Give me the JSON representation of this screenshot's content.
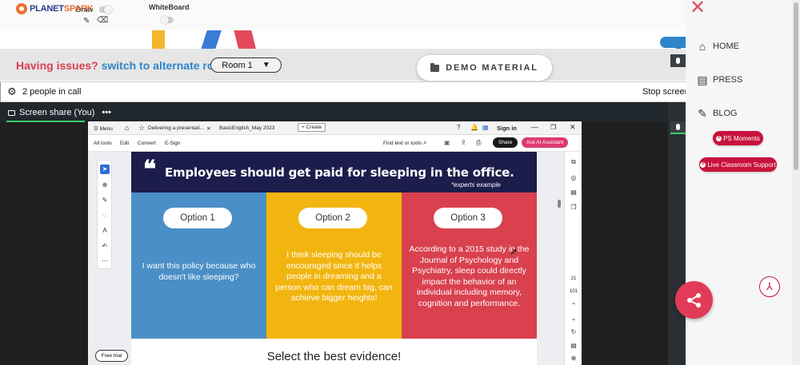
{
  "topbar": {
    "logo_main": "PLANET",
    "logo_spark": "SPARK",
    "draw_label": "Draw",
    "whiteboard_label": "WhiteBoard",
    "pencil_glyph": "✎",
    "eraser_glyph": "⌫"
  },
  "issues": {
    "prefix": "Having issues?",
    "link": "switch to alternate room",
    "room_value": "Room 1",
    "room_arrow": "▼"
  },
  "demo_button": {
    "label": "DEMO MATERIAL"
  },
  "call": {
    "people": "2 people in call",
    "stop": "Stop screen"
  },
  "share": {
    "title": "Screen share (You)",
    "menu": "•••"
  },
  "acrobat": {
    "tabs": {
      "menu": "☰ Menu",
      "home_glyph": "⌂",
      "star_glyph": "☆",
      "tab1": "Delivering a presentati...",
      "tab1_close": "✕",
      "tab2": "BasicEnglish_May 2023",
      "new_tab": "+ Create",
      "help_glyph": "?",
      "bell_glyph": "🔔",
      "apps_glyph": "▦",
      "signin": "Sign in",
      "min_glyph": "—",
      "max_glyph": "❐",
      "close_glyph": "✕"
    },
    "menubar": {
      "all_tools": "All tools",
      "edit": "Edit",
      "convert": "Convert",
      "esign": "E-Sign",
      "find": "Find text or tools",
      "search_glyph": "⌕",
      "save_glyph": "▣",
      "upload_glyph": "⇪",
      "print_glyph": "⎙",
      "share": "Share",
      "ai": "Ask AI Assistant"
    },
    "tools": [
      "➤",
      "⊕",
      "✎",
      "◌",
      "A",
      "✍",
      "⋯"
    ],
    "right_tools": [
      "⧉",
      "◎",
      "▤",
      "❐"
    ],
    "page_current": "21",
    "page_total": "101",
    "nav_glyphs": [
      "⌃",
      "⌄",
      "↻",
      "▤",
      "⊕"
    ],
    "free_trial": "Free trial"
  },
  "slide": {
    "quote": "❝",
    "title": "Employees should get paid for sleeping in the office.",
    "subtitle": "*experts example",
    "options": [
      {
        "label": "Option 1",
        "text": "I want this policy because who doesn't like sleeping?"
      },
      {
        "label": "Option 2",
        "text": "I think sleeping should be encouraged since it helps people in dreaming and a person who can dream big, can achieve bigger heights!"
      },
      {
        "label": "Option 3",
        "text": "According to a 2015 study in the Journal of Psychology and Psychiatry, sleep could directly impact the behavior of an individual including memory, cognition and performance."
      }
    ],
    "footer": "Select the best evidence!"
  },
  "rightnav": {
    "close_glyph": "✕",
    "home": "HOME",
    "home_glyph": "⌂",
    "press": "PRESS",
    "press_glyph": "▤",
    "blog": "BLOG",
    "blog_glyph": "✎",
    "ps_moments": "PS Moments",
    "live_support": "Live Classroom Support",
    "pill_glyph": "✕",
    "pdf_glyph": "⅄"
  },
  "colors": {
    "brand_red": "#d9414f",
    "link_blue": "#2f84c9",
    "slide_navy": "#1c1d4b",
    "option_blue": "#4a8fc7",
    "option_yellow": "#f2b510",
    "option_red": "#d9414f",
    "pill_red": "#c8123c"
  }
}
